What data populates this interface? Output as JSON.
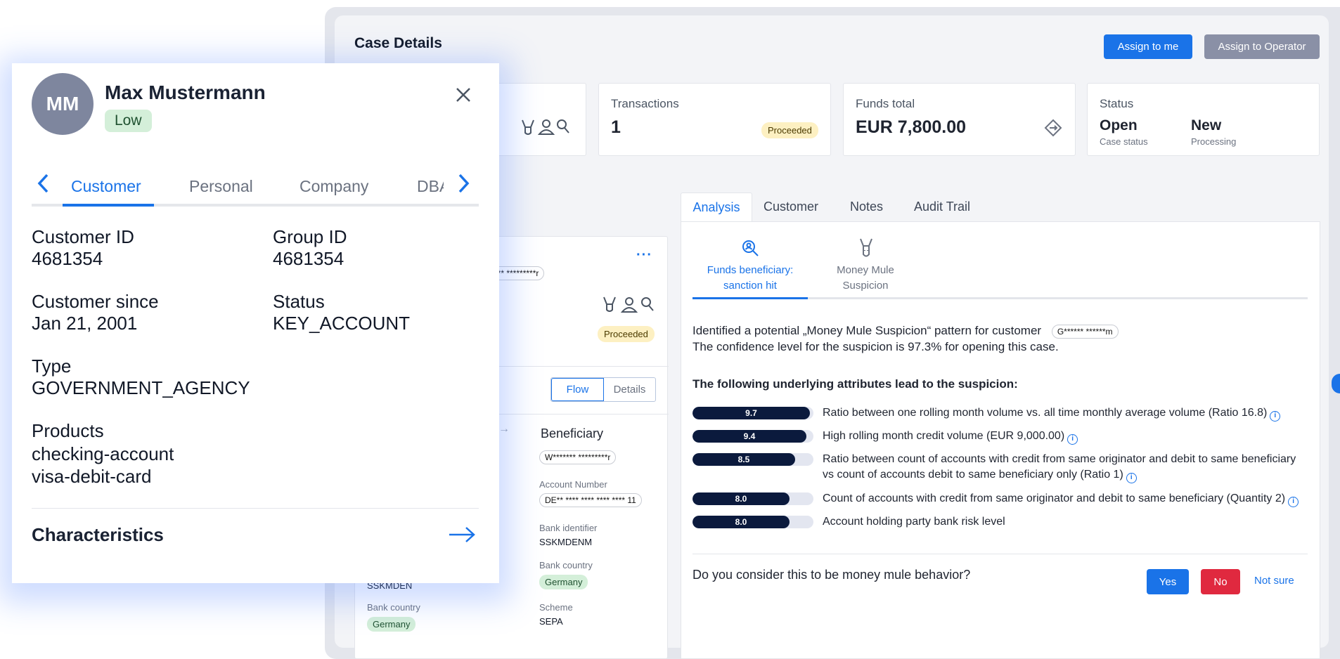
{
  "case": {
    "title": "Case Details",
    "assign_me": "Assign to me",
    "assign_operator": "Assign to Operator"
  },
  "summary": {
    "transactions": {
      "label": "Transactions",
      "value": "1",
      "badge": "Proceeded"
    },
    "funds": {
      "label": "Funds total",
      "value": "EUR 7,800.00"
    },
    "status": {
      "label": "Status",
      "case_status_value": "Open",
      "case_status_label": "Case status",
      "processing_value": "New",
      "processing_label": "Processing"
    }
  },
  "left_panel": {
    "masked_top": "*** *********r",
    "badge": "Proceeded",
    "toggle": {
      "flow": "Flow",
      "details": "Details"
    },
    "beneficiary": {
      "title": "Beneficiary",
      "masked_name": "W******* *********r",
      "account_number_label": "Account Number",
      "account_number": "DE** **** **** **** **** 11",
      "bank_identifier_label": "Bank identifier",
      "bank_identifier": "SSKMDENM",
      "bank_country_label": "Bank country",
      "bank_country": "Germany",
      "scheme_label": "Scheme",
      "scheme": "SEPA"
    },
    "originator": {
      "bank_identifier": "SSKMDEN",
      "bank_country_label": "Bank country",
      "bank_country": "Germany"
    }
  },
  "tabs": [
    "Analysis",
    "Customer",
    "Notes",
    "Audit Trail"
  ],
  "analysis": {
    "subtabs": [
      {
        "label_line1": "Funds beneficiary:",
        "label_line2": "sanction hit",
        "icon": "search-person-icon"
      },
      {
        "label_line1": "Money Mule",
        "label_line2": "Suspicion",
        "icon": "donkey-icon"
      }
    ],
    "intro_line1": "Identified a potential „Money Mule Suspicion“ pattern for customer",
    "customer_masked": "G****** ******m",
    "intro_line2": "The confidence level for the suspicion is 97.3% for opening this case.",
    "attributes_heading": "The following underlying attributes lead to the suspicion:",
    "attributes": [
      {
        "score": "9.7",
        "fraction": 0.97,
        "text": "Ratio between one rolling month volume vs. all time monthly average volume (Ratio 16.8)"
      },
      {
        "score": "9.4",
        "fraction": 0.94,
        "text": "High rolling month credit volume (EUR 9,000.00)"
      },
      {
        "score": "8.5",
        "fraction": 0.85,
        "text": "Ratio between count of accounts with credit from same originator and debit to same beneficiary vs count of accounts debit to same beneficiary only (Ratio 1)"
      },
      {
        "score": "8.0",
        "fraction": 0.8,
        "text": "Count of accounts with credit from same originator and debit to same beneficiary (Quantity 2)"
      },
      {
        "score": "8.0",
        "fraction": 0.8,
        "text": "Account holding party bank risk level"
      }
    ],
    "question": "Do you consider this to be money mule behavior?",
    "yes": "Yes",
    "no": "No",
    "not_sure": "Not sure"
  },
  "customer_popup": {
    "initials": "MM",
    "name": "Max Mustermann",
    "risk": "Low",
    "tabs": [
      "Customer",
      "Personal",
      "Company",
      "DBA"
    ],
    "customer_id_label": "Customer ID",
    "customer_id": "4681354",
    "group_id_label": "Group ID",
    "group_id": "4681354",
    "customer_since_label": "Customer since",
    "customer_since": "Jan 21, 2001",
    "status_label": "Status",
    "status": "KEY_ACCOUNT",
    "type_label": "Type",
    "type": "GOVERNMENT_AGENCY",
    "products_label": "Products",
    "products": [
      "checking-account",
      "visa-debit-card"
    ],
    "characteristics": "Characteristics"
  },
  "colors": {
    "primary": "#1a73e8",
    "danger": "#e0293f",
    "bar_fill": "#0b1a3d",
    "grey_button": "#8a90a6"
  }
}
